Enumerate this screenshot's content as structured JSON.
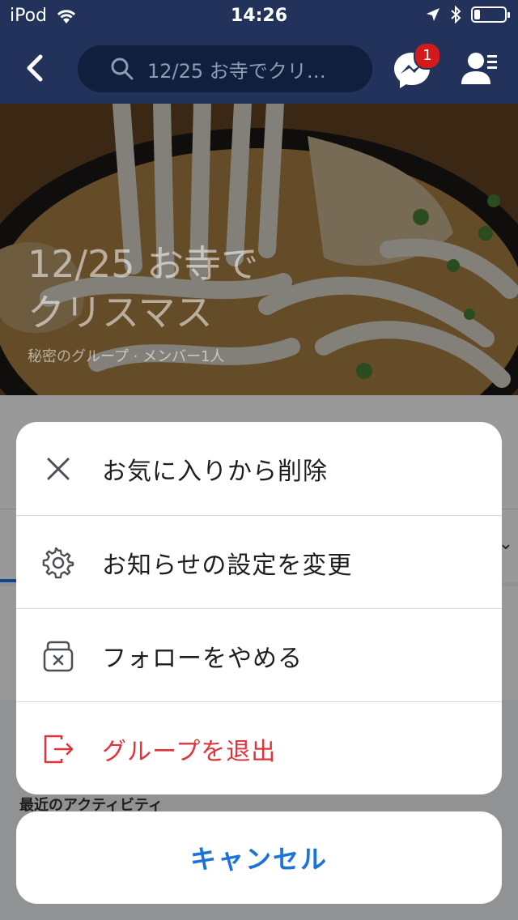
{
  "status_bar": {
    "carrier": "iPod",
    "time": "14:26",
    "battery_level": 0.2,
    "icons": [
      "wifi-icon",
      "location-arrow-icon",
      "bluetooth-icon",
      "battery-icon"
    ]
  },
  "nav": {
    "search_text": "12/25 お寺でクリ…",
    "messenger_badge": "1",
    "icons": [
      "back-chevron-icon",
      "search-icon",
      "messenger-icon",
      "profile-icon"
    ]
  },
  "cover": {
    "title_line1": "12/25 お寺で",
    "title_line2": "クリスマス",
    "subtitle": "秘密のグループ · メンバー1人"
  },
  "behind": {
    "recent_activity": "最近のアクティビティ"
  },
  "action_sheet": {
    "items": [
      {
        "label": "お気に入りから削除",
        "icon": "close-icon"
      },
      {
        "label": "お知らせの設定を変更",
        "icon": "gear-icon"
      },
      {
        "label": "フォローをやめる",
        "icon": "unfollow-icon"
      },
      {
        "label": "グループを退出",
        "icon": "leave-icon",
        "color": "#e0333a"
      }
    ],
    "cancel_label": "キャンセル"
  },
  "colors": {
    "nav": "#22325a",
    "accent": "#1a73d9",
    "danger": "#e0333a"
  }
}
